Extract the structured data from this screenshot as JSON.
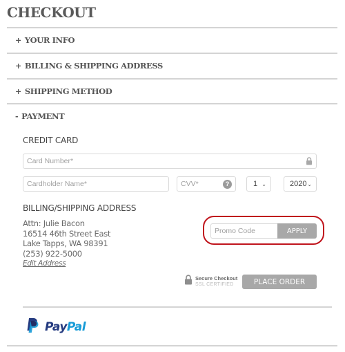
{
  "page": {
    "title": "CHECKOUT"
  },
  "colors": {
    "accent_ring": "#c0141c",
    "button_disabled": "#a8a8a8",
    "paypal_dark": "#253b80",
    "paypal_light": "#179bd7"
  },
  "sections": [
    {
      "toggle": "+",
      "label": "YOUR INFO",
      "expanded": false
    },
    {
      "toggle": "+",
      "label": "BILLING & SHIPPING ADDRESS",
      "expanded": false
    },
    {
      "toggle": "+",
      "label": "SHIPPING METHOD",
      "expanded": false
    },
    {
      "toggle": "-",
      "label": "PAYMENT",
      "expanded": true
    }
  ],
  "payment": {
    "credit_card_heading": "CREDIT CARD",
    "card_number": {
      "placeholder": "Card Number*",
      "value": "",
      "icon": "lock-icon"
    },
    "cardholder_name": {
      "placeholder": "Cardholder Name*",
      "value": ""
    },
    "cvv": {
      "placeholder": "CVV*",
      "value": "",
      "help_glyph": "?"
    },
    "exp_month": {
      "selected": "1"
    },
    "exp_year": {
      "selected": "2020"
    },
    "address_heading": "BILLING/SHIPPING ADDRESS",
    "address_lines": [
      "Attn: Julie Bacon",
      "16514 46th Street East",
      "Lake Tapps, WA 98391",
      "(253) 922-5000"
    ],
    "edit_address_label": "Edit Address",
    "promo": {
      "placeholder": "Promo Code",
      "value": "",
      "apply_label": "APPLY"
    },
    "secure": {
      "title": "Secure Checkout",
      "subtitle": "SSL CERTIFIED"
    },
    "place_order_label": "PLACE ORDER"
  },
  "paypal": {
    "word_part1": "Pay",
    "word_part2": "Pal"
  }
}
